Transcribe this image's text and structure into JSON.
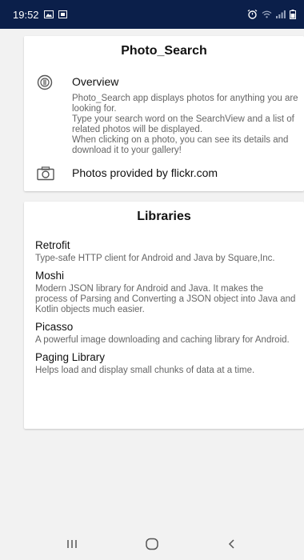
{
  "status_bar": {
    "time": "19:52",
    "icons_left": [
      "image-icon",
      "notification-icon"
    ],
    "icons_right": [
      "alarm-icon",
      "wifi-icon",
      "signal-icon",
      "battery-icon"
    ]
  },
  "about": {
    "title": "Photo_Search",
    "overview_icon": "info-icon",
    "overview_title": "Overview",
    "overview_text": "Photo_Search app displays photos for anything you are looking for.\n Type your search word on the SearchView and a list of related photos will be displayed.\n When clicking on a photo, you can see its details and download it to your gallery!",
    "provider_icon": "camera-icon",
    "provider_text": "Photos provided by flickr.com"
  },
  "libraries": {
    "title": "Libraries",
    "items": [
      {
        "name": "Retrofit",
        "description": "Type-safe HTTP client for Android and Java by Square,Inc."
      },
      {
        "name": "Moshi",
        "description": "Modern JSON library for Android and Java. It makes the process of Parsing and Converting a JSON object into Java and Kotlin objects much easier."
      },
      {
        "name": "Picasso",
        "description": "A powerful image downloading and caching library for Android."
      },
      {
        "name": "Paging Library",
        "description": "Helps load and display small chunks of data at a time."
      }
    ]
  },
  "nav_bar": {
    "buttons": [
      "recents-icon",
      "home-icon",
      "back-icon"
    ]
  },
  "colors": {
    "status_bar": "#0b1f4a",
    "background": "#f2f2f2",
    "card": "#ffffff",
    "secondary_text": "#666666"
  }
}
